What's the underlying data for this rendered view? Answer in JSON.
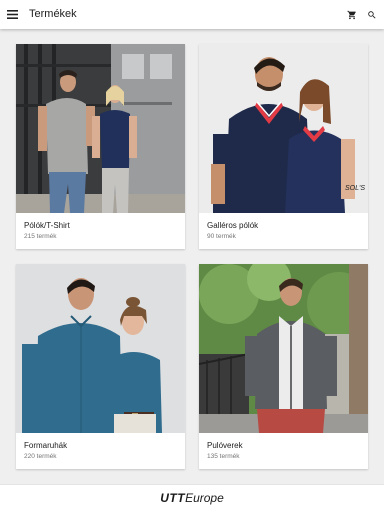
{
  "app_bar": {
    "title": "Termékek",
    "icons": [
      "menu-icon",
      "cart-icon",
      "search-icon"
    ]
  },
  "categories": [
    {
      "name": "Pólók/T-Shirt",
      "count": "215 termék"
    },
    {
      "name": "Galléros pólók",
      "count": "90 termék",
      "brand_mark": "SOL'S"
    },
    {
      "name": "Formaruhák",
      "count": "220 termék"
    },
    {
      "name": "Pulóverek",
      "count": "135 termék"
    }
  ],
  "footer": {
    "logo_bold": "UTT",
    "logo_rest": "Europe"
  }
}
